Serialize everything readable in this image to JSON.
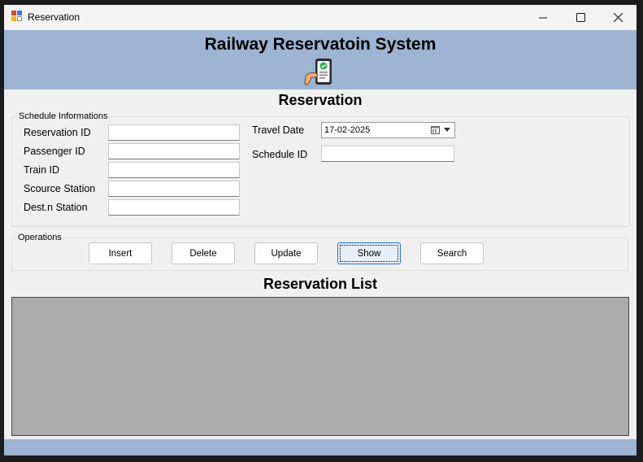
{
  "window": {
    "title": "Reservation"
  },
  "header": {
    "title": "Railway Reservatoin System"
  },
  "form": {
    "heading": "Reservation",
    "group_label": "Schedule Informations",
    "fields": [
      {
        "label": "Reservation ID",
        "value": ""
      },
      {
        "label": "Passenger ID",
        "value": ""
      },
      {
        "label": "Train ID",
        "value": ""
      },
      {
        "label": "Scource Station",
        "value": ""
      },
      {
        "label": "Dest.n Station",
        "value": ""
      }
    ],
    "travel_date": {
      "label": "Travel Date",
      "value": "17-02-2025"
    },
    "schedule_id": {
      "label": "Schedule ID",
      "value": ""
    }
  },
  "operations": {
    "group_label": "Operations",
    "buttons": [
      "Insert",
      "Delete",
      "Update",
      "Show",
      "Search"
    ]
  },
  "list": {
    "heading": "Reservation List"
  },
  "colors": {
    "header_bg": "#9db4d2",
    "grid_bg": "#ababab",
    "window_bg": "#f0f0f0",
    "focus_border": "#2a6fd1"
  },
  "icons": [
    "app-icon",
    "minimize-icon",
    "maximize-icon",
    "close-icon",
    "ticket-phone-icon",
    "calendar-icon",
    "chevron-down-icon"
  ]
}
